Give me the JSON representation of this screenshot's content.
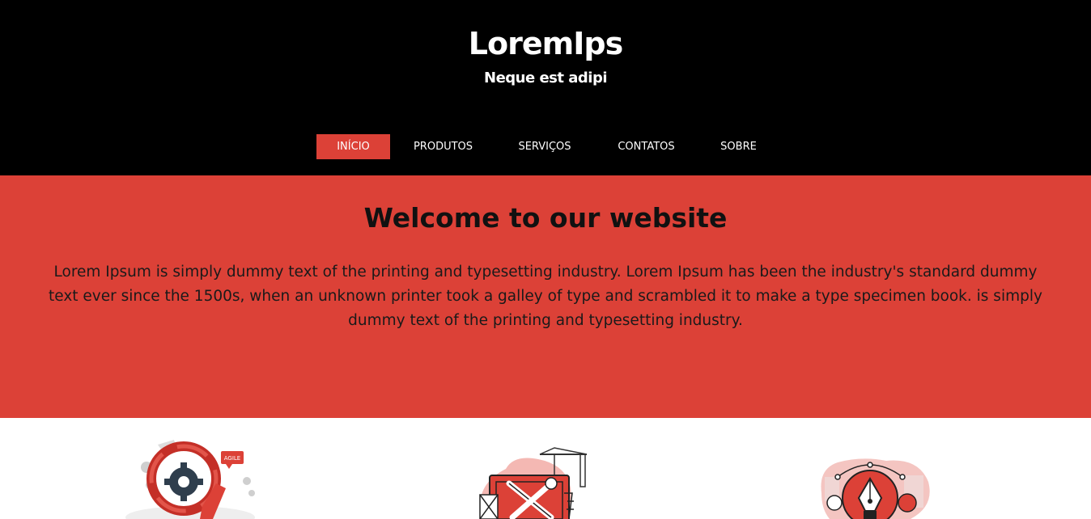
{
  "header": {
    "title": "LoremIps",
    "subtitle": "Neque est adipi"
  },
  "nav": {
    "items": [
      {
        "label": "INÍCIO",
        "active": true
      },
      {
        "label": "PRODUTOS",
        "active": false
      },
      {
        "label": "SERVIÇOS",
        "active": false
      },
      {
        "label": "CONTATOS",
        "active": false
      },
      {
        "label": "SOBRE",
        "active": false
      }
    ]
  },
  "hero": {
    "title": "Welcome to our website",
    "text": "Lorem Ipsum is simply dummy text of the printing and typesetting industry. Lorem Ipsum has been the industry's standard dummy text ever since the 1500s, when an unknown printer took a galley of type and scrambled it to make a type specimen book. is simply dummy text of the printing and typesetting industry."
  },
  "features": {
    "agile_badge": "AGILE"
  },
  "colors": {
    "accent": "#dc4137",
    "header_bg": "#000000",
    "text_dark": "#111111"
  },
  "icons": [
    "agile-gear-illustration",
    "tools-crane-illustration",
    "pen-tool-design-illustration"
  ]
}
